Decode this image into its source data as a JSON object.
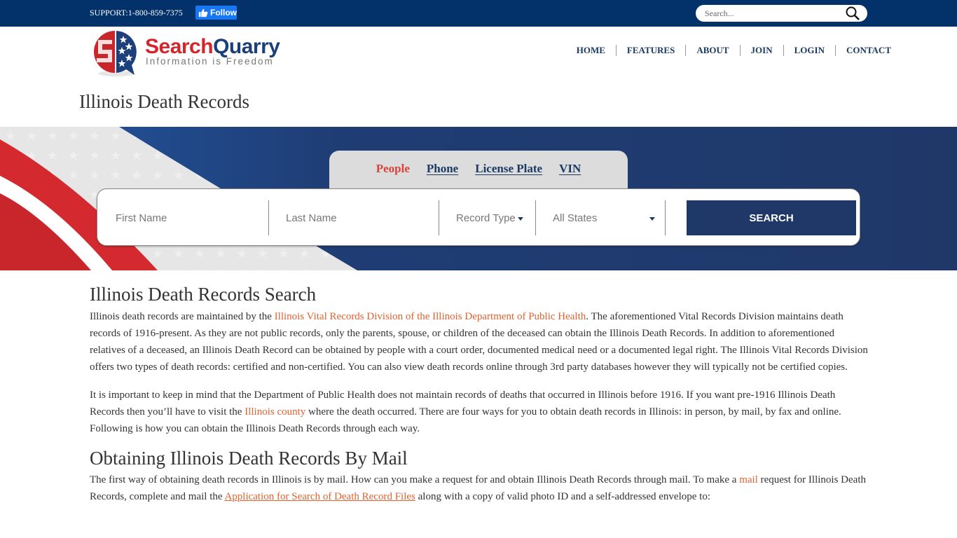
{
  "topbar": {
    "support": "SUPPORT:1-800-859-7375",
    "follow_label": "Follow",
    "search_placeholder": "Search..."
  },
  "logo": {
    "name_part1": "Search",
    "name_part2": "Quarry",
    "tagline": "Information is Freedom"
  },
  "nav": {
    "items": [
      {
        "label": "HOME"
      },
      {
        "label": "FEATURES"
      },
      {
        "label": "ABOUT"
      },
      {
        "label": "JOIN"
      },
      {
        "label": "LOGIN"
      },
      {
        "label": "CONTACT"
      }
    ]
  },
  "page_title": "Illinois Death Records",
  "search": {
    "tabs": [
      {
        "label": "People",
        "active": true
      },
      {
        "label": "Phone",
        "active": false
      },
      {
        "label": "License Plate",
        "active": false
      },
      {
        "label": "VIN",
        "active": false
      }
    ],
    "first_name_placeholder": "First Name",
    "last_name_placeholder": "Last Name",
    "record_type": "Record Type",
    "state": "All States",
    "button_label": "SEARCH",
    "colors": {
      "accent": "#1f3868",
      "active_tab": "#d9423a"
    }
  },
  "content": {
    "section1_heading": "Illinois Death Records Search",
    "p1": {
      "before_link": "Illinois death records are maintained by the ",
      "link": "Illinois Vital Records Division of the Illinois Department of Public Health",
      "after_link": ". The aforementioned Vital Records Division maintains death records of 1916-present. As they are not public records, only the parents, spouse, or children of the deceased can obtain the Illinois Death Records. In addition to aforementioned relatives of a deceased, an Illinois Death Record can be obtained by people with a court order, documented medical need or a documented legal right. The Illinois Vital Records Division offers two types of death records: certified and non-certified. You can also view death records online through 3rd party databases however they will typically not be certified copies."
    },
    "p2": {
      "before_link": "It is important to keep in mind that the Department of Public Health does not maintain records of deaths that occurred in Illinois before 1916. If you want pre-1916 Illinois Death Records then you’ll have to visit the ",
      "link": "Illinois county",
      "after_link": " where the death occurred. There are four ways for you to obtain death records in Illinois: in person, by mail, by fax and online. Following is how you can obtain the Illinois Death Records through each way."
    },
    "section2_heading": "Obtaining Illinois Death Records By Mail",
    "p3": {
      "part1": "The first way of obtaining death records in Illinois is by mail. How can you make a request for and obtain Illinois Death Records through mail. To make a ",
      "link1": "mail",
      "part2": " request for Illinois Death Records, complete and mail the ",
      "link2": "Application for Search of Death Record Files",
      "part3": " along with a copy of valid photo ID and a self-addressed envelope to:"
    },
    "link_color": "#e2622f"
  }
}
